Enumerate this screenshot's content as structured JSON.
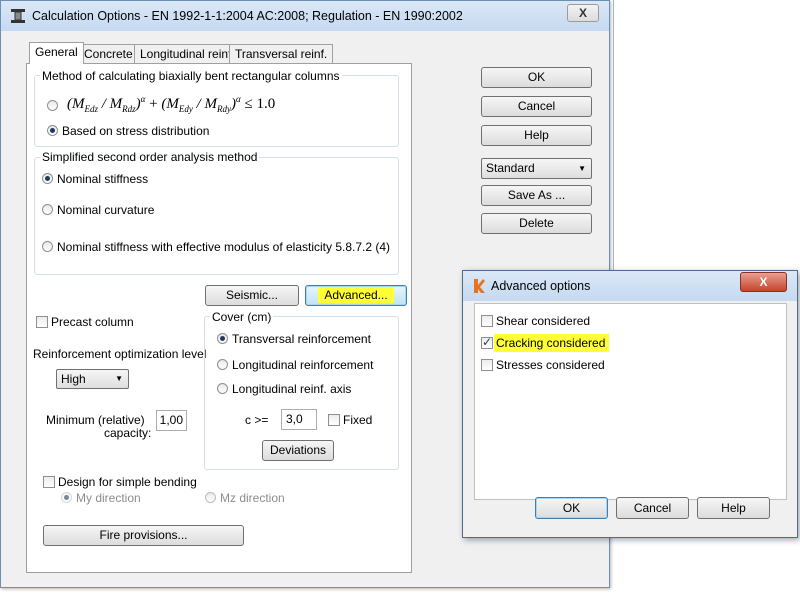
{
  "main_window": {
    "title": "Calculation Options - EN 1992-1-1:2004 AC:2008;   Regulation - EN 1990:2002",
    "close_label": "X",
    "tabs": [
      "General",
      "Concrete",
      "Longitudinal reinf.",
      "Transversal reinf."
    ],
    "biaxial_group": {
      "label": "Method of calculating biaxially bent rectangular columns",
      "formula": {
        "m1": "M",
        "s1": "Edz",
        "m2": "M",
        "s2": "Rdz",
        "e1": "α",
        "plus": "+",
        "m3": "M",
        "s3": "Edy",
        "m4": "M",
        "s4": "Rdy",
        "e2": "α",
        "rhs": "≤ 1.0"
      },
      "option_stress": "Based on stress distribution"
    },
    "second_order_group": {
      "label": "Simplified second order analysis method",
      "options": [
        "Nominal stiffness",
        "Nominal curvature",
        "Nominal stiffness with effective modulus of elasticity 5.8.7.2 (4)"
      ]
    },
    "seismic_button": "Seismic...",
    "advanced_button": "Advanced...",
    "precast_label": "Precast column",
    "optimization_label": "Reinforcement optimization level",
    "optimization_value": "High",
    "min_capacity_label_1": "Minimum (relative)",
    "min_capacity_label_2": "capacity:",
    "min_capacity_value": "1,00",
    "cover_group": {
      "label": "Cover (cm)",
      "options": [
        "Transversal reinforcement",
        "Longitudinal reinforcement",
        "Longitudinal reinf. axis"
      ],
      "c_label": "c >=",
      "c_value": "3,0",
      "fixed_label": "Fixed",
      "deviations_button": "Deviations"
    },
    "simple_bending_label": "Design for simple bending",
    "my_direction": "My direction",
    "mz_direction": "Mz direction",
    "fire_button": "Fire provisions...",
    "side_buttons": {
      "ok": "OK",
      "cancel": "Cancel",
      "help": "Help",
      "standard": "Standard",
      "save_as": "Save As ...",
      "delete": "Delete"
    }
  },
  "advanced_dialog": {
    "title": "Advanced options",
    "close_label": "X",
    "options": [
      {
        "label": "Shear considered",
        "checked": false
      },
      {
        "label": "Cracking considered",
        "checked": true
      },
      {
        "label": "Stresses considered",
        "checked": false
      }
    ],
    "ok": "OK",
    "cancel": "Cancel",
    "help": "Help"
  },
  "colors": {
    "highlight": "#ffff33",
    "titlebar": "#c5d9f1",
    "close_red": "#c7432b",
    "app_icon_orange": "#e8731e"
  },
  "icons": {
    "main_app_icon": "column-icon",
    "advanced_app_icon": "app-logo-icon"
  }
}
